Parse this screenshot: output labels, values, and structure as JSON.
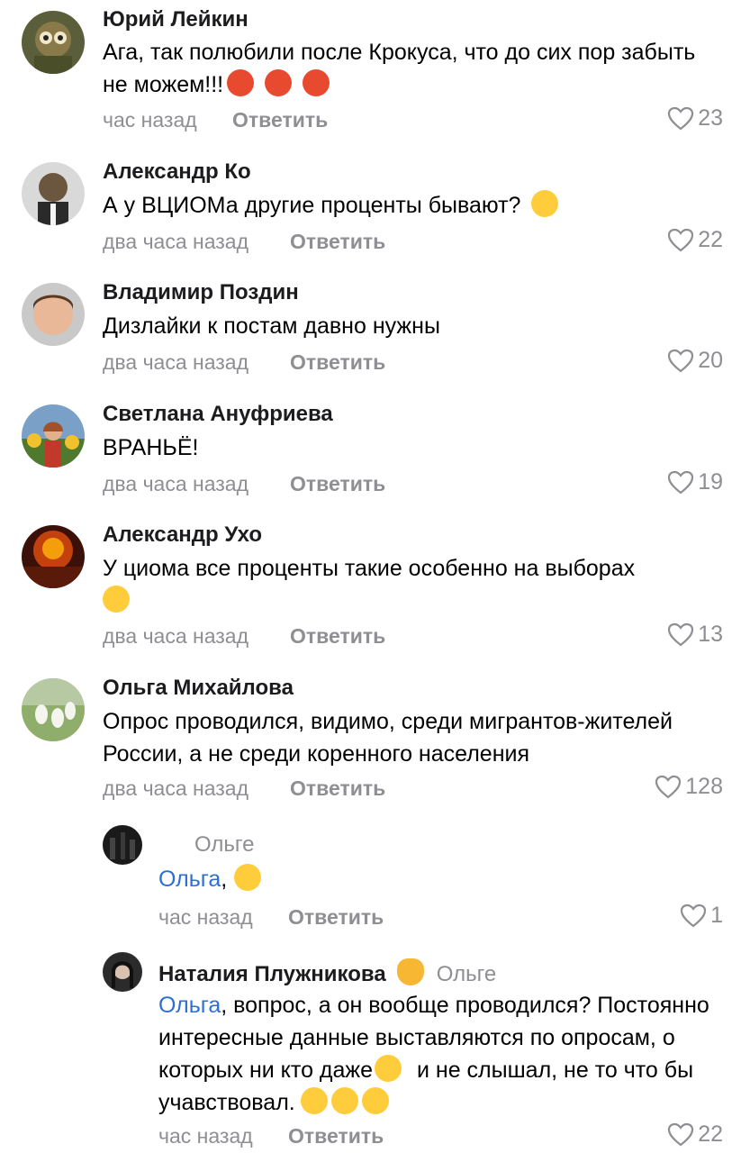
{
  "comments": [
    {
      "name": "Юрий Лейкин",
      "text": "Ага, так полюбили после Крокуса, что до сих пор забыть не можем!!!",
      "time": "час назад",
      "reply": "Ответить",
      "likes": "23"
    },
    {
      "name": "Александр Ко",
      "text": "А у ВЦИОМа другие проценты бывают?",
      "time": "два часа назад",
      "reply": "Ответить",
      "likes": "22"
    },
    {
      "name": "Владимир Поздин",
      "text": "Дизлайки к постам давно нужны",
      "time": "два часа назад",
      "reply": "Ответить",
      "likes": "20"
    },
    {
      "name": "Светлана Ануфриева",
      "text": "ВРАНЬЁ!",
      "time": "два часа назад",
      "reply": "Ответить",
      "likes": "19"
    },
    {
      "name": "Александр Ухо",
      "text": "У циома все проценты такие особенно на выборах",
      "time": "два часа назад",
      "reply": "Ответить",
      "likes": "13"
    },
    {
      "name": "Ольга Михайлова",
      "text": "Опрос проводился, видимо, среди мигрантов-жителей России, а не среди коренного населения",
      "time": "два часа назад",
      "reply": "Ответить",
      "likes": "128"
    }
  ],
  "replies": [
    {
      "name": "",
      "to": "Ольге",
      "mention": "Ольга",
      "text": ",",
      "time": "час назад",
      "reply": "Ответить",
      "likes": "1"
    },
    {
      "name": "Наталия Плужникова",
      "to": "Ольге",
      "mention": "Ольга",
      "text": ", вопрос, а он вообще проводился? Постоянно интересные данные выставляются по опросам, о которых ни кто даже",
      "text_tail": " и не слышал, не то что бы учавствовал.",
      "time": "час назад",
      "reply": "Ответить",
      "likes": "22"
    }
  ],
  "colors": {
    "meta": "#8e8e93",
    "mention": "#2c6fd6",
    "name": "#1c1c1e"
  },
  "icons": {
    "like": "heart-outline-icon"
  }
}
